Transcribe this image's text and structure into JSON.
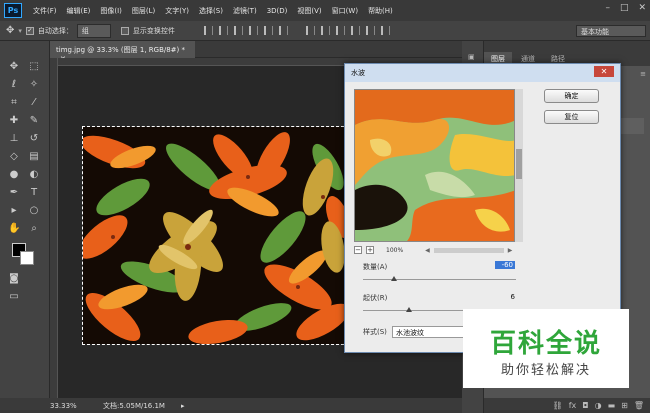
{
  "app": {
    "logo_text": "Ps"
  },
  "menubar": {
    "items": [
      "文件(F)",
      "编辑(E)",
      "图像(I)",
      "图层(L)",
      "文字(Y)",
      "选择(S)",
      "滤镜(T)",
      "3D(D)",
      "视图(V)",
      "窗口(W)",
      "帮助(H)"
    ]
  },
  "options": {
    "auto_select_label": "自动选择：",
    "auto_select_value": "组",
    "show_transform_label": "显示变换控件",
    "workspace": "基本功能"
  },
  "document": {
    "tab_title": "timg.jpg @ 33.3% (图层 1, RGB/8#) *",
    "zoom": "33.33%",
    "doc_info": "文档:5.05M/16.1M"
  },
  "panels": {
    "tabs": [
      "图层",
      "通道",
      "路径"
    ]
  },
  "dialog": {
    "title": "水波",
    "ok": "确定",
    "reset": "复位",
    "zoom": "100%",
    "amount_label": "数量(A)",
    "amount_value": "-60",
    "amount_pct": 0.2,
    "ridges_label": "起伏(R)",
    "ridges_value": "6",
    "ridges_pct": 0.3,
    "style_label": "样式(S)",
    "style_value": "水池波纹"
  },
  "watermark": {
    "title": "百科全说",
    "subtitle": "助你轻松解决",
    "color": "#2fa63a"
  }
}
